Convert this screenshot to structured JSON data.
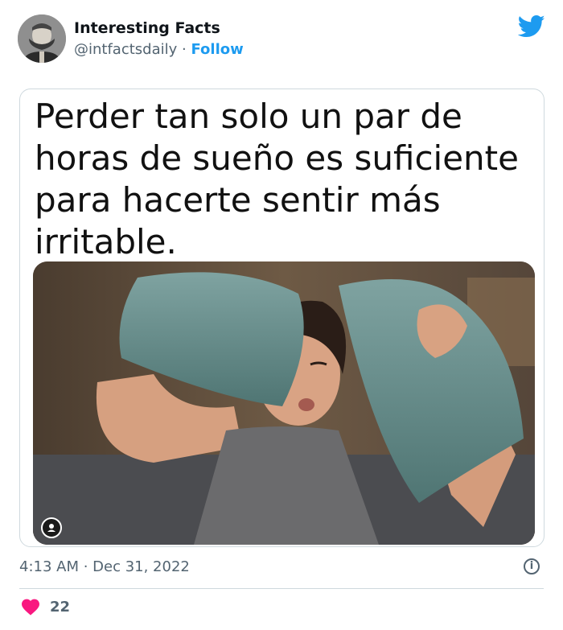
{
  "author": {
    "name": "Interesting Facts",
    "handle": "@intfactsdaily",
    "separator": "·",
    "follow_label": "Follow",
    "avatar_icon": "avatar-portrait",
    "platform_icon": "twitter-bird-icon"
  },
  "card": {
    "text": "Perder tan solo un par de horas de sueño es suficiente para hacerte sentir más irritable."
  },
  "meta": {
    "timestamp": "4:13 AM · Dec 31, 2022",
    "info_icon": "i"
  },
  "engagement": {
    "like_count": "22"
  },
  "colors": {
    "accent": "#1d9bf0",
    "heart": "#f91880",
    "muted": "#536471",
    "border": "#cfd9de"
  }
}
